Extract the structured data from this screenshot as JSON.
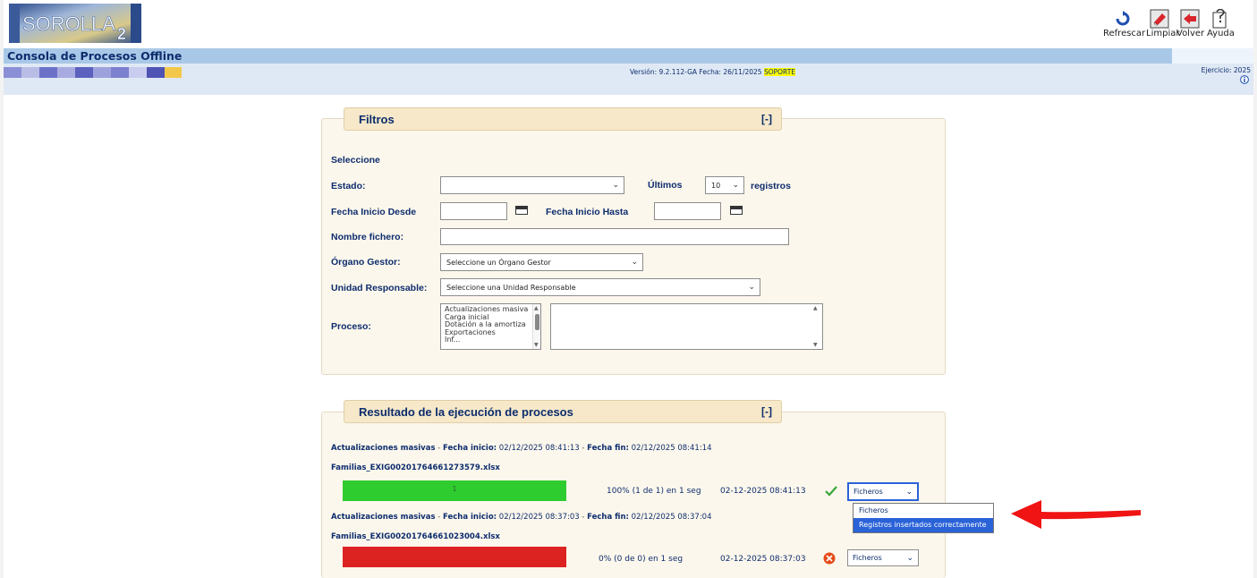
{
  "header": {
    "logo_text": "SOROLLA",
    "logo_sub": "2",
    "tools": [
      {
        "label": "Refrescar",
        "icon": "refresh-icon"
      },
      {
        "label": "Limpiar",
        "icon": "eraser-icon"
      },
      {
        "label": "Volver",
        "icon": "back-icon"
      },
      {
        "label": "Ayuda",
        "icon": "help-icon"
      }
    ],
    "title": "Consola de Procesos Offline",
    "version_prefix": "Versión: 9.2.112-GA Fecha: 26/11/2025 ",
    "version_highlight": "SOPORTE",
    "ejercicio": "Ejercicio: 2025",
    "strip_colors": [
      "#8a8fd6",
      "#b9bde6",
      "#6c71c8",
      "#a7abe0",
      "#5c61be",
      "#9ea2dc",
      "#7c80cf",
      "#c9ccee",
      "#4f53b3",
      "#f3c84a"
    ]
  },
  "filters": {
    "title": "Filtros",
    "toggle": "[-]",
    "seleccione": "Seleccione",
    "estado_label": "Estado:",
    "estado_value": "",
    "ultimos_label": "Últimos",
    "ultimos_value": "10",
    "registros_label": "registros",
    "fecha_desde_label": "Fecha Inicio Desde",
    "fecha_hasta_label": "Fecha Inicio Hasta",
    "nombre_label": "Nombre fichero:",
    "organo_label": "Órgano Gestor:",
    "organo_value": "Seleccione un Órgano Gestor",
    "unidad_label": "Unidad Responsable:",
    "unidad_value": "Seleccione una Unidad Responsable",
    "proceso_label": "Proceso:",
    "proceso_options": [
      "Actualizaciones masiva",
      "Carga inicial",
      "Dotación a la amortiza",
      "Exportaciones",
      "Inf..."
    ]
  },
  "results": {
    "title": "Resultado de la ejecución de procesos",
    "toggle": "[-]",
    "items": [
      {
        "proceso": "Actualizaciones masivas",
        "inicio_label": "Fecha inicio:",
        "inicio": "02/12/2025 08:41:13",
        "fin_label": "Fecha fin:",
        "fin": "02/12/2025 08:41:14",
        "fichero": "Familias_EXIG00201764661273579.xlsx",
        "progress": 1.0,
        "bar_label": "1",
        "bar_color": "#2ecc2e",
        "status_text": "100% (1 de 1) en 1 seg",
        "timestamp": "02-12-2025 08:41:13",
        "status_icon": "check-icon",
        "select_value": "Ficheros"
      },
      {
        "proceso": "Actualizaciones masivas",
        "inicio_label": "Fecha inicio:",
        "inicio": "02/12/2025 08:37:03",
        "fin_label": "Fecha fin:",
        "fin": "02/12/2025 08:37:04",
        "fichero": "Familias_EXIG00201764661023004.xlsx",
        "progress": 1.0,
        "bar_label": "",
        "bar_color": "#dd2222",
        "status_text": "0% (0 de 0) en 1 seg",
        "timestamp": "02-12-2025 08:37:03",
        "status_icon": "error-icon",
        "select_value": "Ficheros"
      }
    ],
    "dropdown_options": [
      "Ficheros",
      "Registros insertados correctamente"
    ],
    "dropdown_selected": "Registros insertados correctamente"
  }
}
